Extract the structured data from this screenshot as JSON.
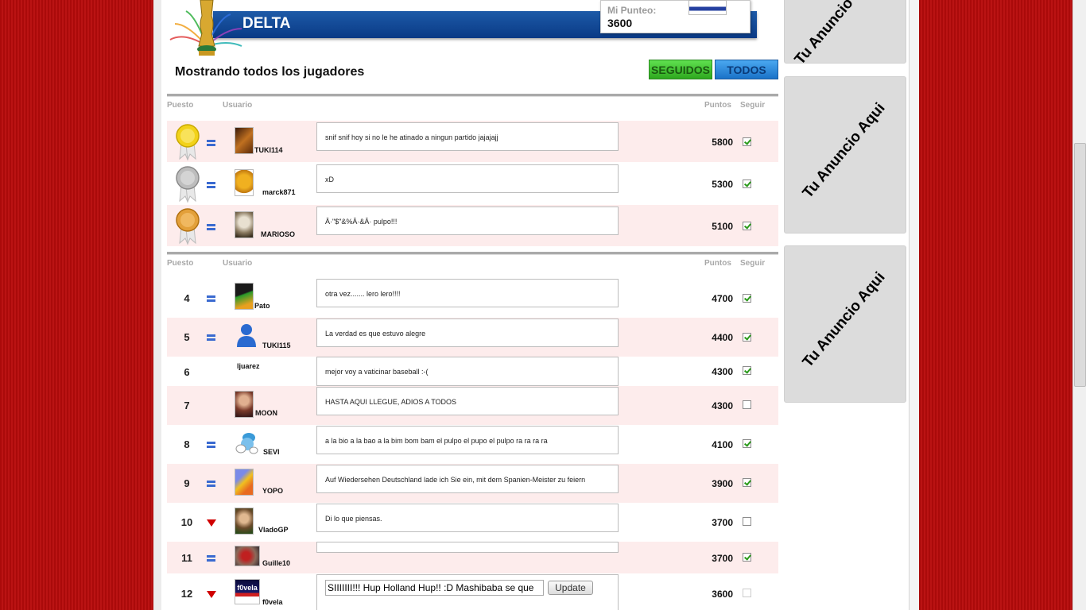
{
  "header": {
    "title": "DELTA",
    "score_label": "Mi Punteo:",
    "score_value": "3600"
  },
  "page_heading": "Mostrando todos los jugadores",
  "tabs": {
    "seguidos": "SEGUIDOS",
    "todos": "TODOS"
  },
  "columns": {
    "puesto": "Puesto",
    "usuario": "Usuario",
    "puntos": "Puntos",
    "seguir": "Seguir"
  },
  "top3": [
    {
      "medal": "gold",
      "trend": "equal",
      "user": "TUKI114",
      "comment": "snif snif hoy si no le he atinado a ningun partido jajajajj",
      "points": "5800",
      "follow": true
    },
    {
      "medal": "silver",
      "trend": "equal",
      "user": "marck871",
      "comment": "xD",
      "points": "5300",
      "follow": true
    },
    {
      "medal": "bronze",
      "trend": "equal",
      "user": "MARIOSO",
      "comment": "Â·\"$\"&%Â·&Â· pulpo!!!",
      "points": "5100",
      "follow": true
    }
  ],
  "rows": [
    {
      "rank": "4",
      "trend": "equal",
      "user": "Pato",
      "comment": "otra vez....... lero lero!!!!",
      "points": "4700",
      "follow": true
    },
    {
      "rank": "5",
      "trend": "equal",
      "user": "TUKI115",
      "comment": "La verdad es que estuvo alegre",
      "points": "4400",
      "follow": true
    },
    {
      "rank": "6",
      "trend": "none",
      "user": "ljuarez",
      "comment": "mejor voy a vaticinar baseball :-(",
      "points": "4300",
      "follow": true
    },
    {
      "rank": "7",
      "trend": "none",
      "user": "MOON",
      "comment": "HASTA AQUI LLEGUE, ADIOS A TODOS",
      "points": "4300",
      "follow": false
    },
    {
      "rank": "8",
      "trend": "equal",
      "user": "SEVI",
      "comment": "a la bio a la bao a la bim bom bam el pulpo el pupo el pulpo ra ra ra ra",
      "points": "4100",
      "follow": true
    },
    {
      "rank": "9",
      "trend": "equal",
      "user": "YOPO",
      "comment": "Auf Wiedersehen Deutschland lade ich Sie ein, mit dem Spanien-Meister zu feiern",
      "points": "3900",
      "follow": true
    },
    {
      "rank": "10",
      "trend": "down",
      "user": "VladoGP",
      "comment": "Di lo que piensas.",
      "points": "3700",
      "follow": false
    },
    {
      "rank": "11",
      "trend": "equal",
      "user": "Guille10",
      "comment": "",
      "points": "3700",
      "follow": true
    },
    {
      "rank": "12",
      "trend": "down",
      "user": "f0vela",
      "comment": "SIIIIIII!!! Hup Holland Hup!! :D Mashibaba se que",
      "points": "3600",
      "follow": false,
      "editable": true,
      "button": "Update",
      "avatar_text": "f0vela"
    }
  ],
  "ads": [
    "Tu Anuncio Aqui",
    "Tu Anuncio Aqui",
    "Tu Anuncio Aqui"
  ],
  "colors": {
    "banner": "#0a3a85",
    "seguidos": "#2ea81e",
    "todos": "#1a72c8",
    "background": "#b80b0b",
    "alt_row": "#fdecec"
  }
}
